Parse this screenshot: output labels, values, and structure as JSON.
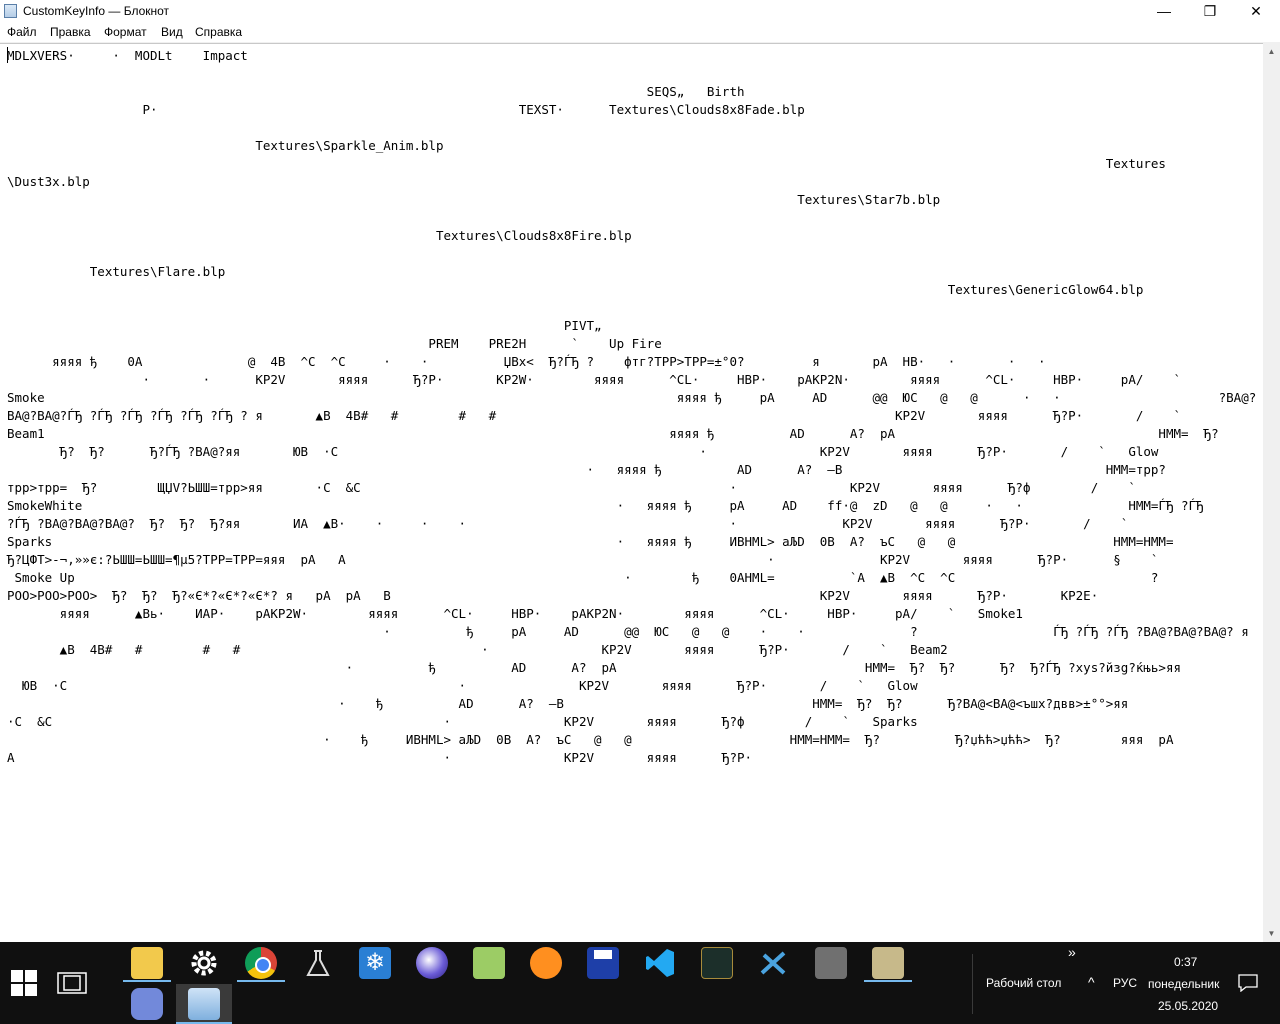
{
  "window": {
    "title": "CustomKeyInfo — Блокнот",
    "minimize_glyph": "—",
    "maximize_glyph": "❐",
    "close_glyph": "✕"
  },
  "menu": [
    {
      "label": "Файл"
    },
    {
      "label": "Правка"
    },
    {
      "label": "Формат"
    },
    {
      "label": "Вид"
    },
    {
      "label": "Справка"
    }
  ],
  "editor": {
    "lines": [
      "MDLXVERS·     ·  MODLt    Impact",
      "",
      "                                                                                     SEQS„   Birth",
      "                  P·                                                TEXST·      Textures\\Clouds8x8Fade.blp",
      "",
      "                                 Textures\\Sparkle_Anim.blp",
      "                                                                                                                                                  Textures",
      "\\Dust3x.blp",
      "                                                                                                         Textures\\Star7b.blp",
      "",
      "                                                         Textures\\Clouds8x8Fire.blp",
      "",
      "           Textures\\Flare.blp",
      "                                                                                                                             Textures\\GenericGlow64.blp",
      "",
      "                                                                          PIVT„",
      "                                                        PREM    PRE2H      `    Up Fire",
      "      яяяя ђ    0A              @  4B  ^C  ^C     ·    ·          ЏВх<  Ђ?ЃЂ ?    фтг?TPP>TPP=±°0?         я       рА  НВ·   ·       ·   ·",
      "                  ·       ·      KP2V       яяяя      Ђ?Р·       KP2W·        яяяя      ^CL·     HBP·    pAKP2N·        яяяя      ^CL·     HBP·     pA/    `",
      "Smoke                                                                                    яяяя ђ     рА     AD      @@  ЮС   @   @      ·   ·                     ?BA@?",
      "BA@?BA@?ЃЂ ?ЃЂ ?ЃЂ ?ЃЂ ?ЃЂ ?ЃЂ ? я       ▲B  4B#   #        #   #                                                     KP2V       яяяя      Ђ?Р·       /    `",
      "Beam1                                                                                   яяяя ђ          AD      А?  рА                                   HMM=  Ђ?",
      "       Ђ?  Ђ?      Ђ?ЃЂ ?BA@?яя       ЮВ  ·С                                                ·               KP2V       яяяя      Ђ?Р·       /    `   Glow",
      "                                                                             ·   яяяя ђ          AD      А?  –B                                   HMM=трр?",
      "трр>трр=  Ђ?        ЩЏV?ЬШШ=трр>яя       ·С  &C                                                 ·               KP2V       яяяя      Ђ?ф        /    `",
      "SmokeWhite                                                                       ·   яяяя ђ     рА     AD    ff·@  zD   @   @     ·   ·              HMM=ЃЂ ?ЃЂ",
      "?ЃЂ ?BA@?BA@?BA@?  Ђ?  Ђ?  Ђ?яя       ИА  ▲B·    ·     ·    ·                                   ·              KP2V       яяяя      Ђ?Р·       /    `",
      "Sparks                                                                           ·   яяяя ђ     ИВHML> аЉD  0В  А?  ъС   @   @                     HMM=HMM=",
      "Ђ?ЦФТ>-¬,»»є:?ЬШШ=ЬШШ=¶µ5?TPP=TPP=яяя  рА   А                                                        ·              KP2V       яяяя      Ђ?Р·      §    `",
      " Smoke Up                                                                         ·        ђ    0AHML=          `A  ▲B  ^C  ^C                          ?",
      "POO>POO>POO>  Ђ?  Ђ?  Ђ?«Є*?«Є*?«Є*? я   рА  рА   В                                                         KP2V       яяяя      Ђ?Р·       KP2E·",
      "       яяяя      ▲Вь·    ИАР·    pAKP2W·        яяяя      ^CL·     HBP·    pAKP2N·        яяяя      ^CL·     HBP·     pA/    `   Smoke1",
      "                                                  ·          ђ     рА     AD      @@  ЮС   @   @    ·    ·              ?                  ЃЂ ?ЃЂ ?ЃЂ ?BA@?BA@?BA@? я",
      "       ▲B  4B#   #        #   #                                ·               KP2V       яяяя      Ђ?Р·       /    `   Beam2",
      "                                             ·          ђ          AD      А?  рА                                 HMM=  Ђ?  Ђ?      Ђ?  Ђ?ЃЂ ?xys?йзg?ќњь>яя",
      "  ЮВ  ·С                                                    ·               KP2V       яяяя      Ђ?Р·       /    `   Glow",
      "                                            ·    ђ          AD      А?  –B                                 HMM=  Ђ?  Ђ?      Ђ?BA@<BA@<ъшх?двв>±°°>яя",
      "·С  &C                                                    ·               KP2V       яяяя      Ђ?ф        /    `   Sparks",
      "                                          ·    ђ     ИВHML> аЉD  0В  А?  ъС   @   @                     HMM=HMM=  Ђ?          Ђ?џћћ>џћћ>  Ђ?        яяя  рА",
      "A                                                         ·               KP2V       яяяя      Ђ?Р·"
    ]
  },
  "taskbar": {
    "pinned": [
      {
        "name": "file-explorer-icon"
      },
      {
        "name": "settings-gear-icon"
      },
      {
        "name": "chrome-browser-icon"
      },
      {
        "name": "flask-app-icon"
      },
      {
        "name": "snowflake-app-icon"
      },
      {
        "name": "orb-app-icon"
      },
      {
        "name": "notepadplusplus-icon"
      },
      {
        "name": "fl-studio-icon"
      },
      {
        "name": "floppy-save-icon"
      },
      {
        "name": "vscode-icon"
      },
      {
        "name": "warcraft-app-icon"
      },
      {
        "name": "scissors-tool-icon"
      },
      {
        "name": "installer-app-icon"
      },
      {
        "name": "notepad-edit-icon"
      }
    ],
    "row2": [
      {
        "name": "discord-icon"
      },
      {
        "name": "notepad-active-icon"
      }
    ],
    "overflow_glyph": "»",
    "desktop_label": "Рабочий стол",
    "tray_chevron": "^",
    "language": "РУС",
    "time": "0:37",
    "day": "понедельник",
    "date": "25.05.2020"
  }
}
